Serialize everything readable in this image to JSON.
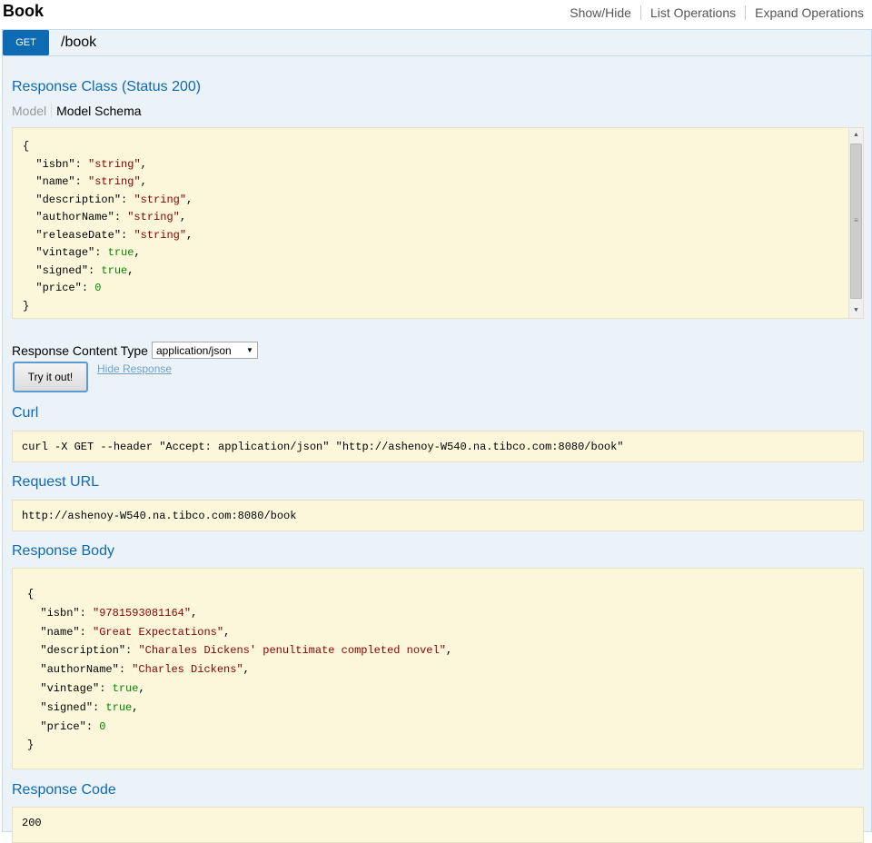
{
  "header": {
    "title": "Book",
    "links": [
      "Show/Hide",
      "List Operations",
      "Expand Operations"
    ]
  },
  "operation": {
    "method": "GET",
    "path": "/book"
  },
  "response_class": {
    "heading": "Response Class (Status 200)",
    "tab_model": "Model",
    "tab_schema": "Model Schema",
    "schema": [
      {
        "key": "\"isbn\"",
        "value": "\"string\"",
        "type": "s"
      },
      {
        "key": "\"name\"",
        "value": "\"string\"",
        "type": "s"
      },
      {
        "key": "\"description\"",
        "value": "\"string\"",
        "type": "s"
      },
      {
        "key": "\"authorName\"",
        "value": "\"string\"",
        "type": "s"
      },
      {
        "key": "\"releaseDate\"",
        "value": "\"string\"",
        "type": "s"
      },
      {
        "key": "\"vintage\"",
        "value": "true",
        "type": "n"
      },
      {
        "key": "\"signed\"",
        "value": "true",
        "type": "n"
      },
      {
        "key": "\"price\"",
        "value": "0",
        "type": "n"
      }
    ]
  },
  "content_type": {
    "label": "Response Content Type",
    "selected": "application/json"
  },
  "actions": {
    "try_it": "Try it out!",
    "hide_response": "Hide Response"
  },
  "curl": {
    "heading": "Curl",
    "command": "curl -X GET --header \"Accept: application/json\" \"http://ashenoy-W540.na.tibco.com:8080/book\""
  },
  "request_url": {
    "heading": "Request URL",
    "url": "http://ashenoy-W540.na.tibco.com:8080/book"
  },
  "response_body": {
    "heading": "Response Body",
    "fields": [
      {
        "key": "\"isbn\"",
        "value": "\"9781593081164\"",
        "type": "s"
      },
      {
        "key": "\"name\"",
        "value": "\"Great Expectations\"",
        "type": "s"
      },
      {
        "key": "\"description\"",
        "value": "\"Charales Dickens' penultimate completed novel\"",
        "type": "s"
      },
      {
        "key": "\"authorName\"",
        "value": "\"Charles Dickens\"",
        "type": "s"
      },
      {
        "key": "\"vintage\"",
        "value": "true",
        "type": "n"
      },
      {
        "key": "\"signed\"",
        "value": "true",
        "type": "n"
      },
      {
        "key": "\"price\"",
        "value": "0",
        "type": "n"
      }
    ]
  },
  "response_code": {
    "heading": "Response Code",
    "code": "200"
  }
}
